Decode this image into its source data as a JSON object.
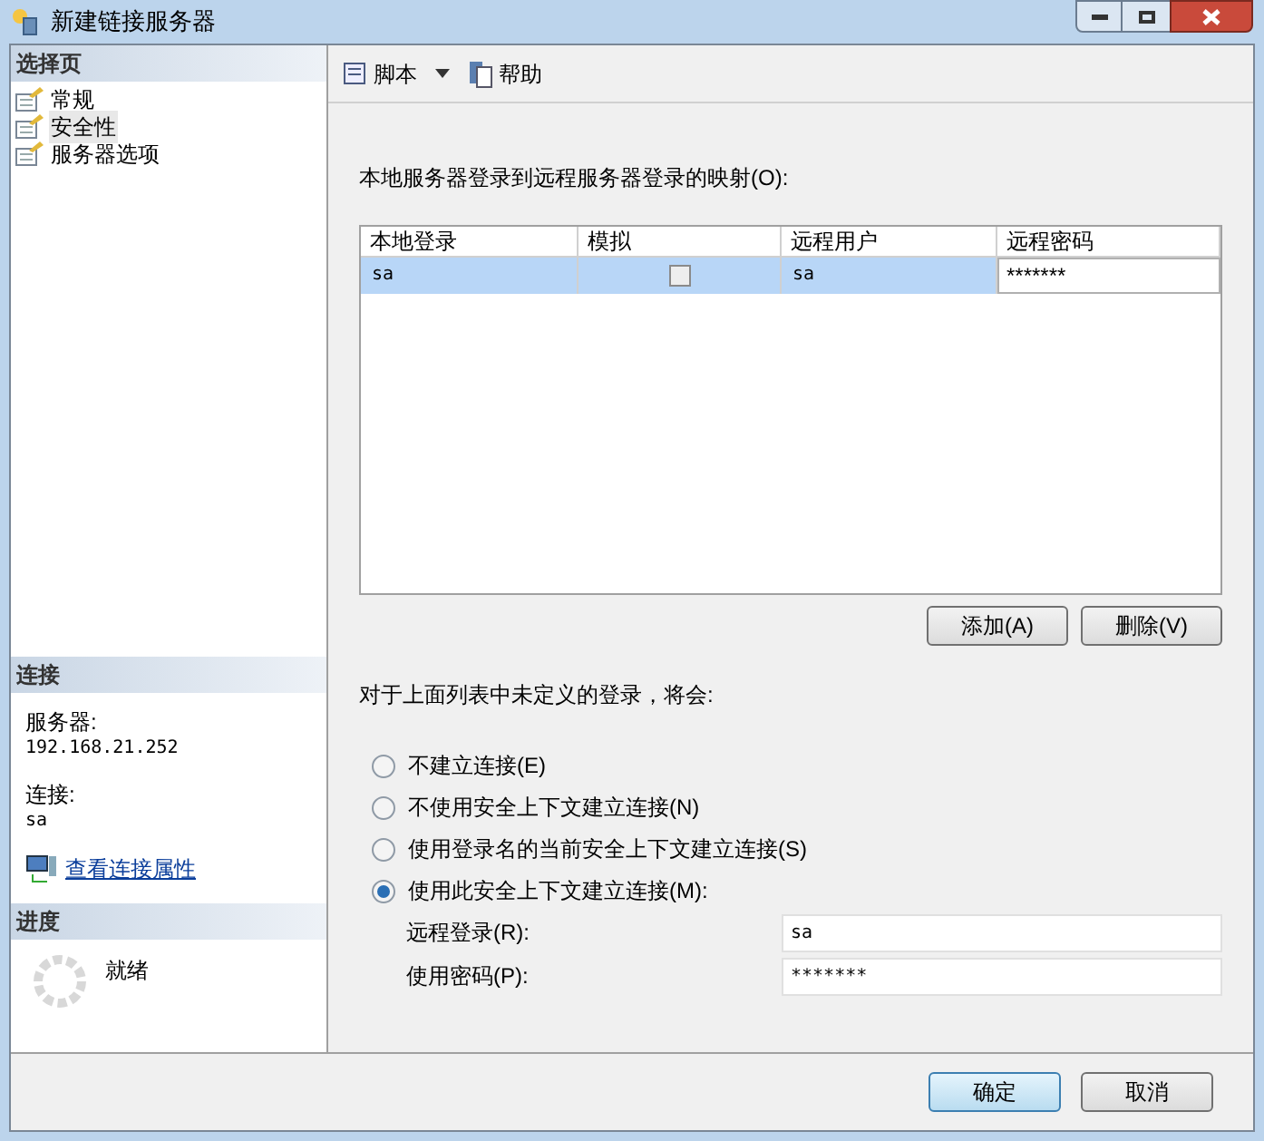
{
  "window": {
    "title": "新建链接服务器"
  },
  "select_page": {
    "title": "选择页",
    "items": [
      {
        "label": "常规",
        "selected": false
      },
      {
        "label": "安全性",
        "selected": true
      },
      {
        "label": "服务器选项",
        "selected": false
      }
    ]
  },
  "connection": {
    "title": "连接",
    "server_label": "服务器:",
    "server": "192.168.21.252",
    "connection_label": "连接:",
    "connection": "sa",
    "link": "查看连接属性"
  },
  "progress": {
    "title": "进度",
    "status": "就绪"
  },
  "toolbar": {
    "script": "脚本",
    "help": "帮助"
  },
  "mapping_label": "本地服务器登录到远程服务器登录的映射(O):",
  "table": {
    "columns": [
      "本地登录",
      "模拟",
      "远程用户",
      "远程密码"
    ],
    "rows": [
      {
        "local_login": "sa",
        "impersonate": false,
        "remote_user": "sa",
        "remote_password": "*******",
        "selected": true
      }
    ]
  },
  "table_buttons": [
    "添加(A)",
    "删除(V)"
  ],
  "undefined_label": "对于上面列表中未定义的登录，将会:",
  "options": [
    {
      "label": "不建立连接(E)",
      "selected": false
    },
    {
      "label": "不使用安全上下文建立连接(N)",
      "selected": false
    },
    {
      "label": "使用登录名的当前安全上下文建立连接(S)",
      "selected": false
    },
    {
      "label": "使用此安全上下文建立连接(M):",
      "selected": true
    }
  ],
  "fields": [
    {
      "label": "远程登录(R):",
      "value": "sa"
    },
    {
      "label": "使用密码(P):",
      "value": "*******"
    }
  ],
  "buttons": [
    "确定",
    "取消"
  ]
}
